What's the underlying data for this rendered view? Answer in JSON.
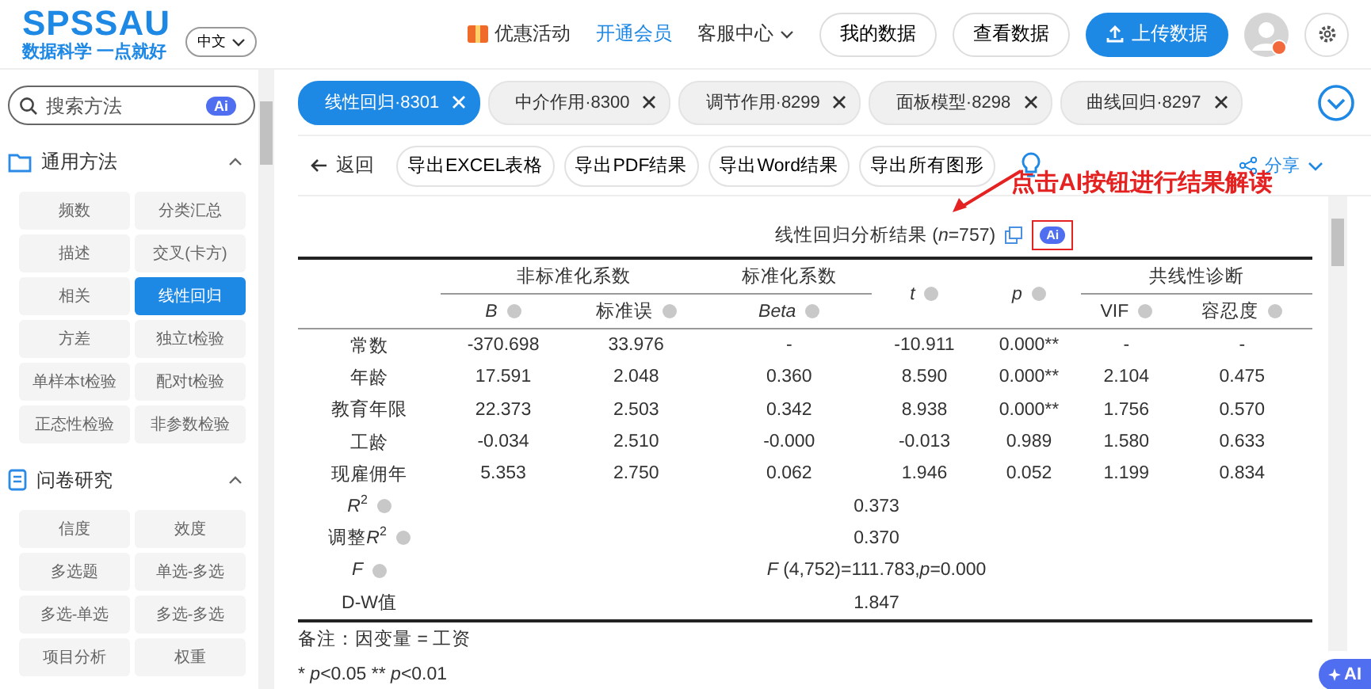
{
  "header": {
    "logo": "SPSSAU",
    "slogan": "数据科学 一点就好",
    "language": "中文",
    "nav": [
      {
        "label": "优惠活动",
        "kind": "promo"
      },
      {
        "label": "开通会员",
        "kind": "highlight"
      },
      {
        "label": "客服中心",
        "kind": "dropdown"
      }
    ],
    "buttons": [
      "我的数据",
      "查看数据"
    ],
    "upload_button": "上传数据"
  },
  "sidebar": {
    "search": {
      "placeholder": "搜索方法",
      "badge": "Ai"
    },
    "sections": [
      {
        "title": "通用方法",
        "expanded": true,
        "items": [
          {
            "label": "频数",
            "selected": false
          },
          {
            "label": "分类汇总",
            "selected": false
          },
          {
            "label": "描述",
            "selected": false
          },
          {
            "label": "交叉(卡方)",
            "selected": false
          },
          {
            "label": "相关",
            "selected": false
          },
          {
            "label": "线性回归",
            "selected": true
          },
          {
            "label": "方差",
            "selected": false
          },
          {
            "label": "独立t检验",
            "selected": false
          },
          {
            "label": "单样本t检验",
            "selected": false
          },
          {
            "label": "配对t检验",
            "selected": false
          },
          {
            "label": "正态性检验",
            "selected": false
          },
          {
            "label": "非参数检验",
            "selected": false
          }
        ]
      },
      {
        "title": "问卷研究",
        "expanded": true,
        "items": [
          {
            "label": "信度",
            "selected": false
          },
          {
            "label": "效度",
            "selected": false
          },
          {
            "label": "多选题",
            "selected": false
          },
          {
            "label": "单选-多选",
            "selected": false
          },
          {
            "label": "多选-单选",
            "selected": false
          },
          {
            "label": "多选-多选",
            "selected": false
          },
          {
            "label": "项目分析",
            "selected": false
          },
          {
            "label": "权重",
            "selected": false
          }
        ]
      }
    ]
  },
  "tabs": [
    {
      "label": "线性回归·8301",
      "selected": true
    },
    {
      "label": "中介作用·8300",
      "selected": false
    },
    {
      "label": "调节作用·8299",
      "selected": false
    },
    {
      "label": "面板模型·8298",
      "selected": false
    },
    {
      "label": "曲线回归·8297",
      "selected": false
    }
  ],
  "toolbar": {
    "back": "返回",
    "buttons": [
      "导出EXCEL表格",
      "导出PDF结果",
      "导出Word结果",
      "导出所有图形"
    ],
    "share": "分享"
  },
  "annotation": "点击AI按钮进行结果解读",
  "result": {
    "title": "线性回归分析结果 (*n*=757)",
    "ai_badge": "Ai",
    "group_headers": [
      "非标准化系数",
      "标准化系数",
      "共线性诊断"
    ],
    "columns": [
      {
        "label": "B",
        "italic": true,
        "help": true
      },
      {
        "label": "标准误",
        "italic": false,
        "help": true
      },
      {
        "label": "Beta",
        "italic": true,
        "help": true
      },
      {
        "label": "t",
        "italic": true,
        "help": true
      },
      {
        "label": "p",
        "italic": true,
        "help": true
      },
      {
        "label": "VIF",
        "italic": false,
        "help": true
      },
      {
        "label": "容忍度",
        "italic": false,
        "help": true
      }
    ],
    "rows": [
      {
        "label": "常数",
        "cells": [
          "-370.698",
          "33.976",
          "-",
          "-10.911",
          "0.000**",
          "-",
          "-"
        ]
      },
      {
        "label": "年龄",
        "cells": [
          "17.591",
          "2.048",
          "0.360",
          "8.590",
          "0.000**",
          "2.104",
          "0.475"
        ]
      },
      {
        "label": "教育年限",
        "cells": [
          "22.373",
          "2.503",
          "0.342",
          "8.938",
          "0.000**",
          "1.756",
          "0.570"
        ]
      },
      {
        "label": "工龄",
        "cells": [
          "-0.034",
          "2.510",
          "-0.000",
          "-0.013",
          "0.989",
          "1.580",
          "0.633"
        ]
      },
      {
        "label": "现雇佣年",
        "cells": [
          "5.353",
          "2.750",
          "0.062",
          "1.946",
          "0.052",
          "1.199",
          "0.834"
        ]
      }
    ],
    "summary": [
      {
        "label": [
          {
            "text": "R",
            "kind": "italic"
          },
          {
            "text": "2",
            "kind": "sup"
          }
        ],
        "help": true,
        "value": "0.373"
      },
      {
        "label": [
          {
            "text": "调整",
            "kind": "plain"
          },
          {
            "text": "R",
            "kind": "italic"
          },
          {
            "text": "2",
            "kind": "sup"
          }
        ],
        "help": true,
        "value": "0.370"
      },
      {
        "label": [
          {
            "text": "F",
            "kind": "italic"
          }
        ],
        "help": true,
        "value": "*F* (4,752)=111.783,*p*=0.000"
      },
      {
        "label": [
          {
            "text": "D-W值",
            "kind": "plain"
          }
        ],
        "help": false,
        "value": "1.847"
      }
    ],
    "note": "备注：因变量 = 工资",
    "footnote": [
      {
        "text": "* ",
        "italic": false
      },
      {
        "text": "p",
        "italic": true
      },
      {
        "text": "<0.05 ** ",
        "italic": false
      },
      {
        "text": "p",
        "italic": true
      },
      {
        "text": "<0.01",
        "italic": false
      }
    ]
  },
  "float_button": "AI"
}
